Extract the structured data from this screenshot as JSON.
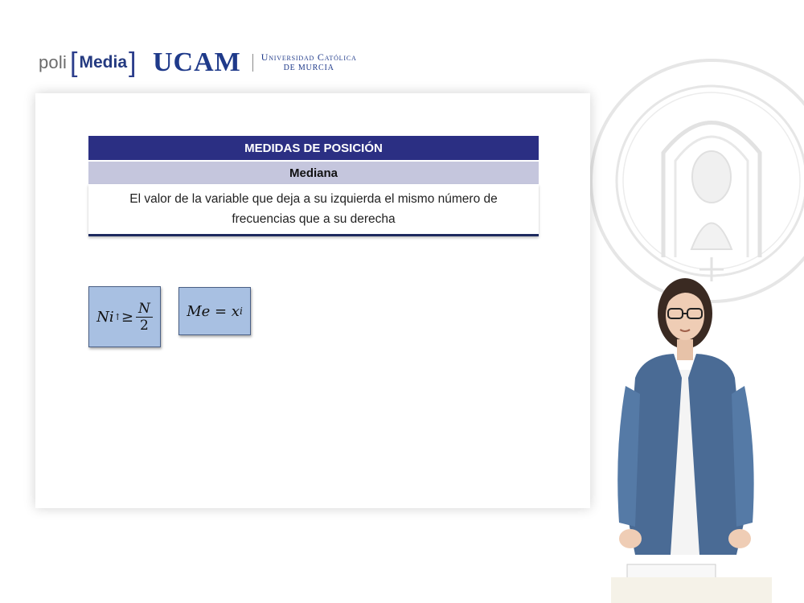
{
  "header": {
    "poli_label": "poli",
    "media_label": "Media",
    "ucam_label": "UCAM",
    "university_line1": "Universidad Católica",
    "university_line2": "DE MURCIA"
  },
  "slide": {
    "title": "MEDIDAS DE POSICIÓN",
    "subtitle": "Mediana",
    "definition_line1": "El valor de la variable que deja a su izquierda el mismo número de",
    "definition_line2": "frecuencias que a su derecha",
    "formula1": {
      "lhs": "Ni",
      "sup": "↑",
      "op": " ≥ ",
      "num": "N",
      "den": "2"
    },
    "formula2": {
      "lhs": "Me = x",
      "sub": "i"
    }
  },
  "colors": {
    "header_bar": "#2b2f83",
    "subheader_bar": "#c5c6dd",
    "formula_box": "#a8c0e2",
    "brand_blue": "#1f3a8a"
  }
}
